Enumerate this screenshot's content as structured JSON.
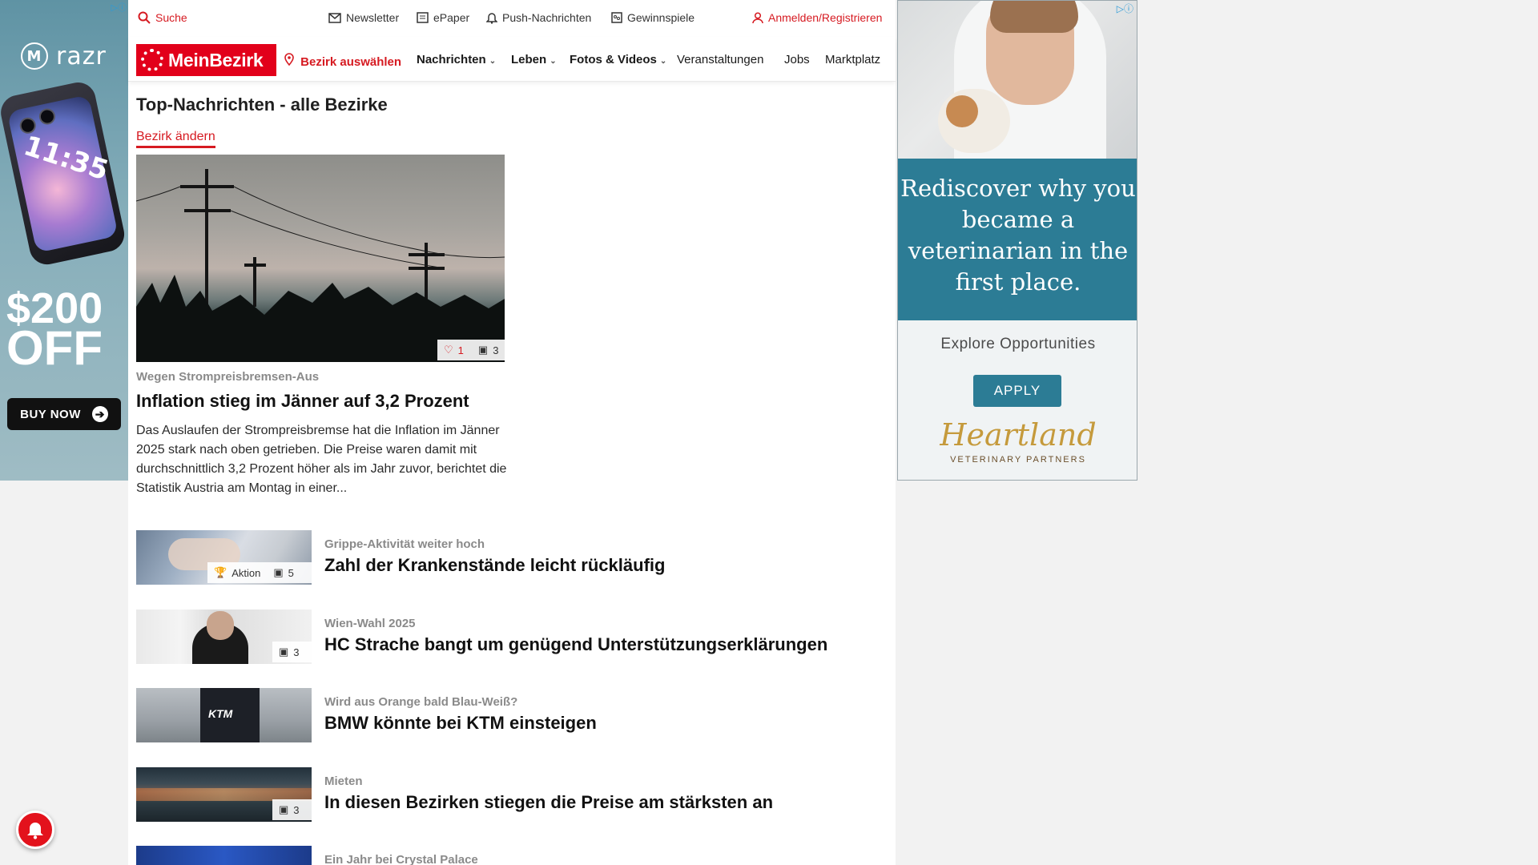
{
  "ad_left": {
    "brand": "razr",
    "phone_time": "11:35",
    "price_line1": "$200",
    "price_line2": "OFF",
    "cta": "BUY NOW"
  },
  "topbar": {
    "search": "Suche",
    "newsletter": "Newsletter",
    "epaper": "ePaper",
    "push": "Push-Nachrichten",
    "gewinnspiele": "Gewinnspiele",
    "login": "Anmelden/Registrieren"
  },
  "nav": {
    "logo": "MeinBezirk",
    "bezirk": "Bezirk auswählen",
    "items": [
      "Nachrichten",
      "Leben",
      "Fotos & Videos",
      "Veranstaltungen",
      "Jobs",
      "Marktplatz"
    ]
  },
  "page": {
    "title": "Top-Nachrichten - alle Bezirke",
    "change_bezirk": "Bezirk ändern"
  },
  "hero": {
    "likes": "1",
    "photos": "3",
    "kicker": "Wegen Strompreisbremsen-Aus",
    "title": "Inflation stieg im Jänner auf 3,2 Prozent",
    "text": "Das Auslaufen der Strompreisbremse hat die Inflation im Jänner 2025 stark nach oben getrieben. Die Preise waren damit mit durchschnittlich 3,2 Prozent höher als im Jahr zuvor, berichtet die Statistik Austria am Montag in einer..."
  },
  "articles": [
    {
      "kicker": "Grippe-Aktivität weiter hoch",
      "title": "Zahl der Krankenstände leicht rückläufig",
      "badge_label": "Aktion",
      "photos": "5"
    },
    {
      "kicker": "Wien-Wahl 2025",
      "title": "HC Strache bangt um genügend Unterstützungserklärungen",
      "photos": "3"
    },
    {
      "kicker": "Wird aus Orange bald Blau-Weiß?",
      "title": "BMW könnte bei KTM einsteigen",
      "thumb_text": "KTM"
    },
    {
      "kicker": "Mieten",
      "title": "In diesen Bezirken stiegen die Preise am stärksten an",
      "photos": "3"
    },
    {
      "kicker": "Ein Jahr bei Crystal Palace",
      "title": ""
    }
  ],
  "ad_right": {
    "headline": "Rediscover why you became a veterinarian in the first place.",
    "explore": "Explore Opportunities",
    "cta": "APPLY",
    "brand": "Heartland",
    "brand_sub": "VETERINARY PARTNERS"
  },
  "colors": {
    "accent": "#e2001a",
    "ad_teal": "#2c7c95"
  }
}
